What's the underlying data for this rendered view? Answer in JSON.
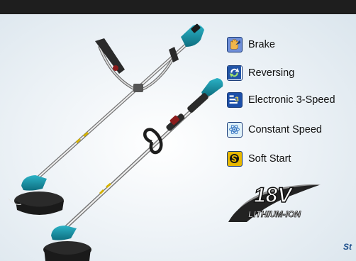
{
  "features": [
    {
      "label": "Brake",
      "icon": "brake-hand-icon"
    },
    {
      "label": "Reversing",
      "icon": "reversing-arrows-icon"
    },
    {
      "label": "Electronic 3-Speed",
      "icon": "three-speed-icon"
    },
    {
      "label": "Constant Speed",
      "icon": "constant-speed-icon"
    },
    {
      "label": "Soft Start",
      "icon": "soft-start-icon"
    }
  ],
  "logo": {
    "voltage": "18V",
    "chemistry": "LITHIUM-ION"
  },
  "corner_text": "St",
  "colors": {
    "topbar": "#1e1e1e",
    "tool_teal": "#1790a5",
    "icon_blue": "#1c3e7a",
    "text": "#111111"
  }
}
